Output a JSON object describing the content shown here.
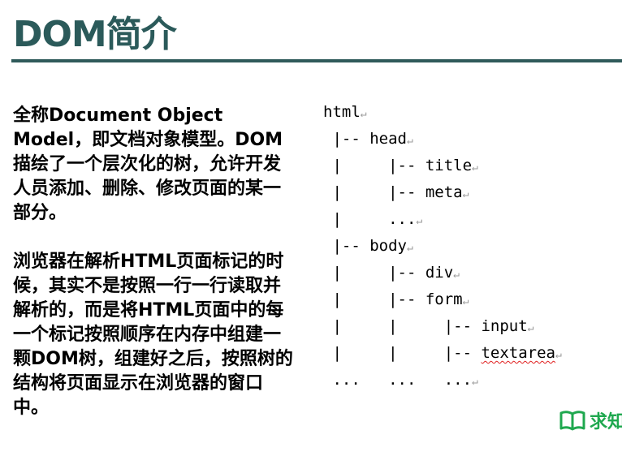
{
  "title": "DOM简介",
  "paragraphs": [
    "全称Document Object Model，即文档对象模型。DOM描绘了一个层次化的树，允许开发人员添加、删除、修改页面的某一部分。",
    "浏览器在解析HTML页面标记的时候，其实不是按照一行一行读取并解析的，而是将HTML页面中的每一个标记按照顺序在内存中组建一颗DOM树，组建好之后，按照树的结构将页面显示在浏览器的窗口中。"
  ],
  "tree": {
    "return_mark": "↵",
    "lines": [
      {
        "prefix": "html",
        "name": ""
      },
      {
        "prefix": " |-- ",
        "name": "head"
      },
      {
        "prefix": " |     |-- ",
        "name": "title"
      },
      {
        "prefix": " |     |-- ",
        "name": "meta"
      },
      {
        "prefix": " |     ",
        "name": "..."
      },
      {
        "prefix": " |-- ",
        "name": "body"
      },
      {
        "prefix": " |     |-- ",
        "name": "div"
      },
      {
        "prefix": " |     |-- ",
        "name": "form"
      },
      {
        "prefix": " |     |     |-- ",
        "name": "input"
      },
      {
        "prefix": " |     |     |-- ",
        "name": "textarea",
        "squiggle": true
      },
      {
        "prefix": " ...   ...   ",
        "name": "..."
      }
    ]
  },
  "watermark": {
    "icon": "book-icon",
    "text": "求知",
    "color": "#1fa84f"
  },
  "colors": {
    "title": "#2b5a5a",
    "rule": "#2f5a5a"
  }
}
